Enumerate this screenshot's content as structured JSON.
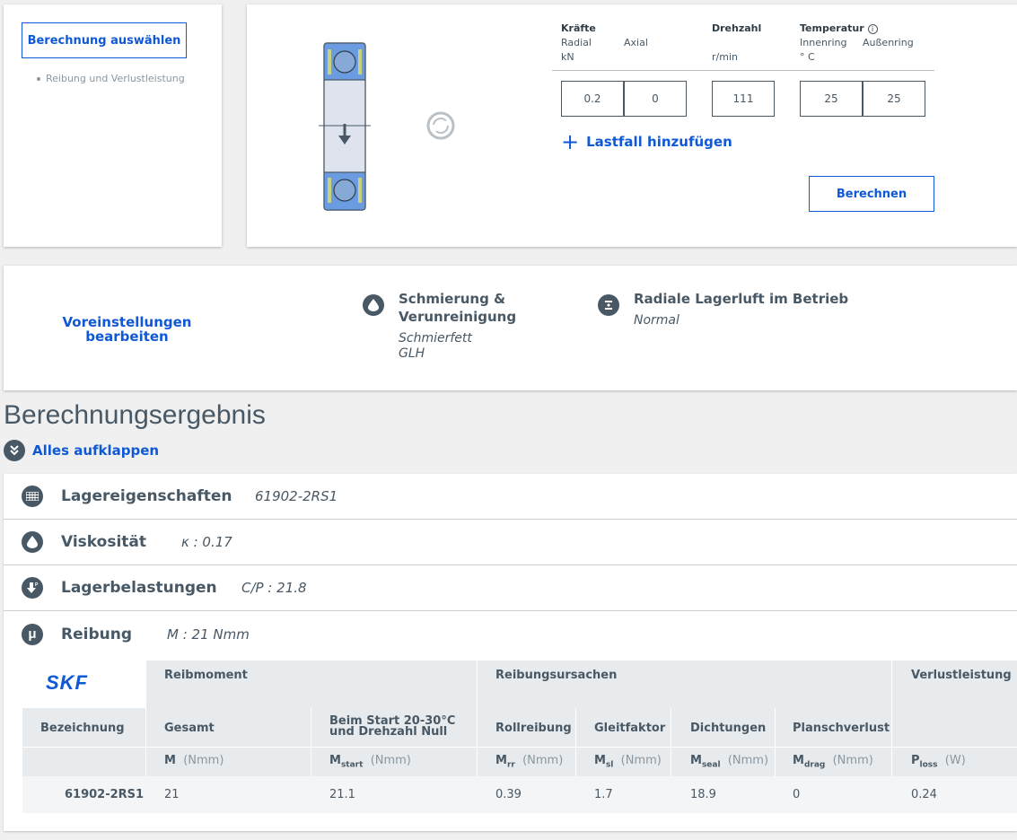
{
  "left_card": {
    "select_button": "Berechnung auswählen",
    "method_item": "Reibung und Verlustleistung"
  },
  "inputs": {
    "forces_header": "Kräfte",
    "radial_label": "Radial",
    "axial_label": "Axial",
    "force_unit": "kN",
    "speed_header": "Drehzahl",
    "speed_unit": "r/min",
    "temp_header": "Temperatur",
    "inner_label": "Innenring",
    "outer_label": "Außenring",
    "temp_unit": "° C",
    "radial_value": "0.2",
    "axial_value": "0",
    "speed_value": "111",
    "inner_value": "25",
    "outer_value": "25",
    "add_case": "Lastfall hinzufügen",
    "calc_button": "Berechnen"
  },
  "presets": {
    "edit_link": "Voreinstellungen bearbeiten",
    "lubrication_title": "Schmierung & Verunreinigung",
    "lubrication_line1": "Schmierfett",
    "lubrication_line2": "GLH",
    "clearance_title": "Radiale Lagerluft im Betrieb",
    "clearance_value": "Normal"
  },
  "results": {
    "title": "Berechnungsergebnis",
    "expand_all": "Alles aufklappen",
    "rows": [
      {
        "name": "Lagereigenschaften",
        "value": "61902-2RS1"
      },
      {
        "name": "Viskosität",
        "value": "κ :   0.17"
      },
      {
        "name": "Lagerbelastungen",
        "value": "C/P :   21.8"
      },
      {
        "name": "Reibung",
        "value": "M :   21 Nmm"
      }
    ],
    "friction_icon": "μ"
  },
  "table": {
    "logo": "SKF",
    "group_moment": "Reibmoment",
    "group_causes": "Reibungsursachen",
    "group_loss": "Verlustleistung",
    "col_name": "Bezeichnung",
    "col_total": "Gesamt",
    "col_start_1": "Beim Start 20-30°C",
    "col_start_2": "und Drehzahl Null",
    "col_roll": "Rollreibung",
    "col_slide": "Gleitfaktor",
    "col_seal": "Dichtungen",
    "col_drag": "Planschverlust",
    "sym_total": "M",
    "sym_start": "M",
    "sub_start": "start",
    "sym_rr": "M",
    "sub_rr": "rr",
    "sym_sl": "M",
    "sub_sl": "sl",
    "sym_seal": "M",
    "sub_seal": "seal",
    "sym_drag": "M",
    "sub_drag": "drag",
    "sym_loss": "P",
    "sub_loss": "loss",
    "unit_nmm": "(Nmm)",
    "unit_w": "(W)",
    "row": {
      "name": "61902-2RS1",
      "total": "21",
      "start": "21.1",
      "roll": "0.39",
      "slide": "1.7",
      "seal": "18.9",
      "drag": "0",
      "loss": "0.24"
    }
  }
}
